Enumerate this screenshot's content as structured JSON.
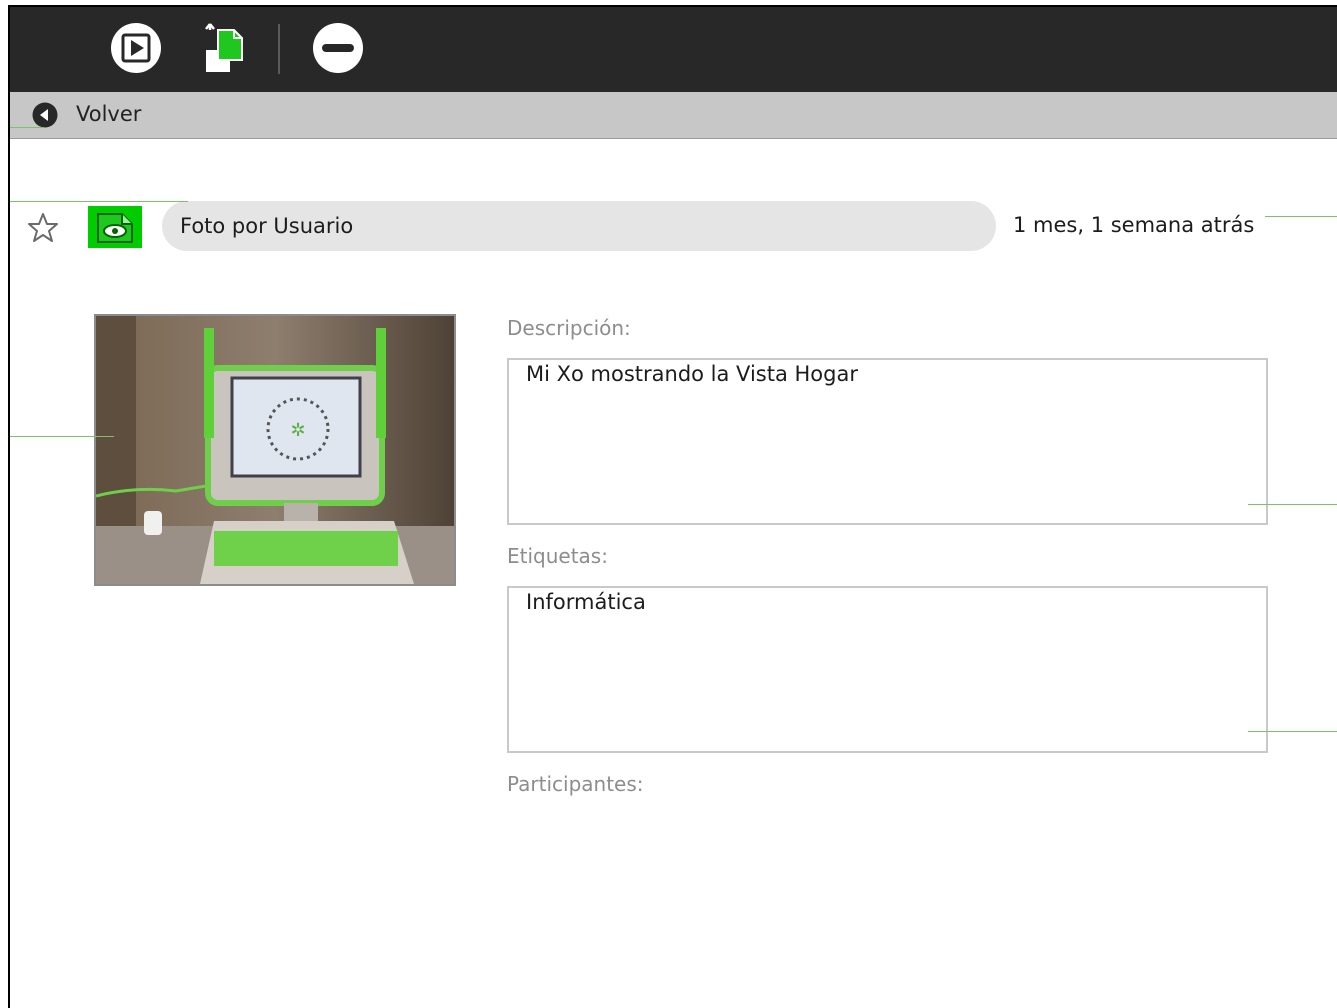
{
  "toolbar": {
    "icons": [
      "play-icon",
      "copy-to-icon",
      "erase-icon"
    ]
  },
  "back": {
    "label": "Volver"
  },
  "entry": {
    "title": "Foto por Usuario",
    "date": "1 mes, 1 semana atrás"
  },
  "fields": {
    "description_label": "Descripción:",
    "description_value": "Mi Xo mostrando la Vista Hogar",
    "tags_label": "Etiquetas:",
    "tags_value": "Informática",
    "participants_label": "Participantes:"
  },
  "colors": {
    "toolbar": "#282828",
    "backbar": "#c8c7c8",
    "activity_green": "#00cc00",
    "guide_green": "#7ac36a"
  }
}
